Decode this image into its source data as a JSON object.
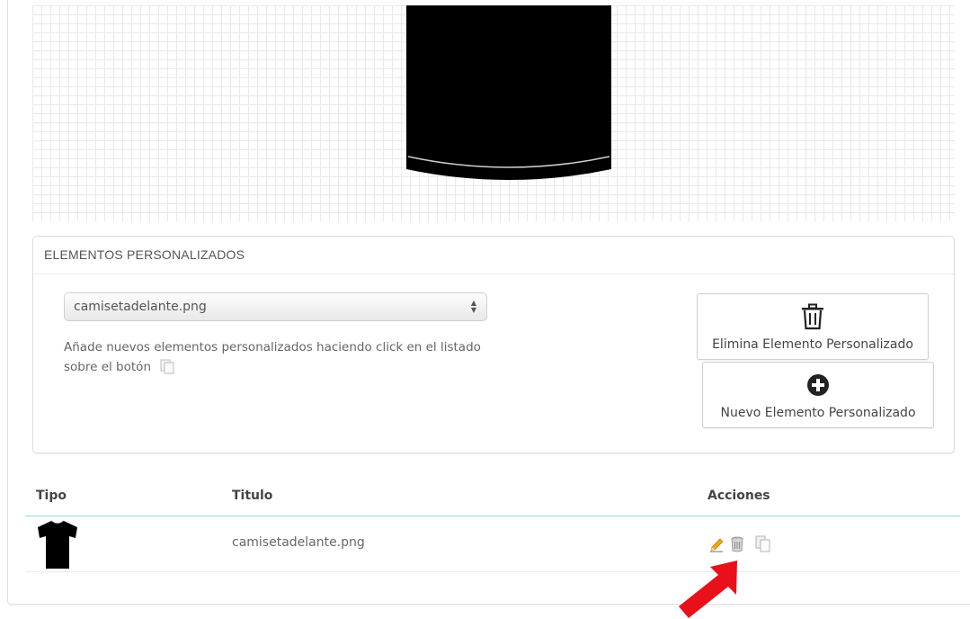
{
  "custom_elements": {
    "heading": "ELEMENTOS PERSONALIZADOS",
    "select": {
      "value": "camisetadelante.png"
    },
    "help_text": "Añade nuevos elementos personalizados haciendo click en el listado sobre el botón",
    "delete_button": {
      "label": "Elimina Elemento Personalizado",
      "icon": "trash-icon"
    },
    "new_button": {
      "label": "Nuevo Elemento Personalizado",
      "icon": "plus-circle-icon"
    }
  },
  "table": {
    "headers": {
      "tipo": "Tipo",
      "titulo": "Titulo",
      "acciones": "Acciones"
    },
    "rows": [
      {
        "tipo_icon": "tshirt-icon",
        "titulo": "camisetadelante.png",
        "actions": [
          "edit-icon",
          "delete-icon",
          "copy-icon"
        ]
      }
    ]
  },
  "colors": {
    "header_rule": "#9cd3e2",
    "arrow": "#e8101a",
    "edit_pencil": "#f2a51a"
  }
}
